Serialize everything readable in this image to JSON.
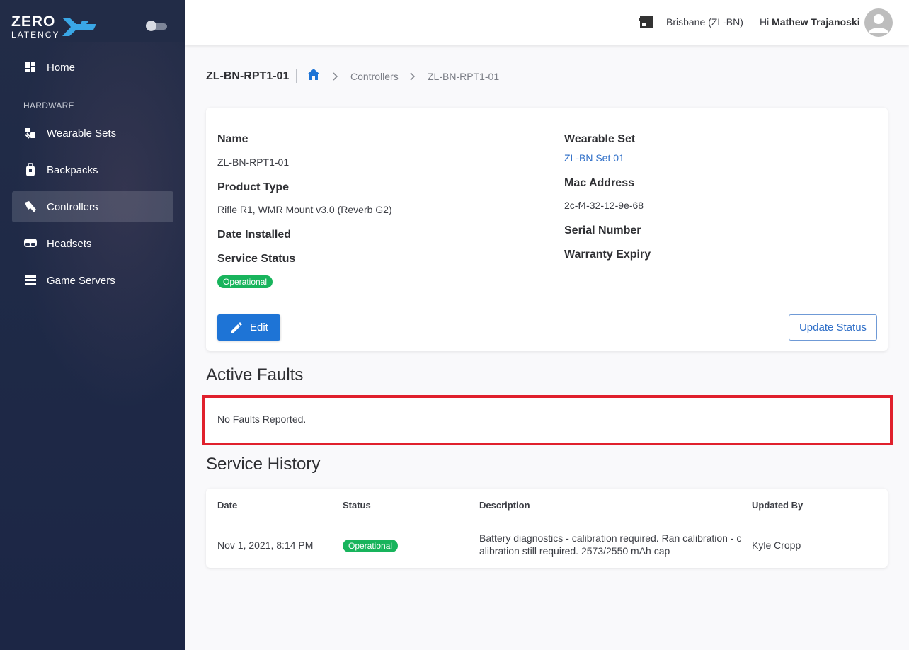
{
  "brand": {
    "line1": "ZERO",
    "line2": "LATENCY"
  },
  "sidebar": {
    "section_hardware": "HARDWARE",
    "items": [
      {
        "label": "Home",
        "icon": "dashboard-icon"
      },
      {
        "label": "Wearable Sets",
        "icon": "wearable-set-icon"
      },
      {
        "label": "Backpacks",
        "icon": "backpack-icon"
      },
      {
        "label": "Controllers",
        "icon": "controller-icon",
        "active": true
      },
      {
        "label": "Headsets",
        "icon": "headset-icon"
      },
      {
        "label": "Game Servers",
        "icon": "server-icon"
      }
    ]
  },
  "topbar": {
    "location": "Brisbane (ZL-BN)",
    "greeting_prefix": "Hi",
    "user_name": "Mathew Trajanoski"
  },
  "breadcrumb": {
    "title": "ZL-BN-RPT1-01",
    "items": [
      "Controllers",
      "ZL-BN-RPT1-01"
    ]
  },
  "details": {
    "name_label": "Name",
    "name_value": "ZL-BN-RPT1-01",
    "product_type_label": "Product Type",
    "product_type_value": "Rifle R1, WMR Mount v3.0 (Reverb G2)",
    "date_installed_label": "Date Installed",
    "service_status_label": "Service Status",
    "service_status_value": "Operational",
    "wearable_set_label": "Wearable Set",
    "wearable_set_value": "ZL-BN Set 01",
    "mac_label": "Mac Address",
    "mac_value": "2c-f4-32-12-9e-68",
    "serial_label": "Serial Number",
    "warranty_label": "Warranty Expiry",
    "edit_button": "Edit",
    "update_status_button": "Update Status"
  },
  "faults": {
    "title": "Active Faults",
    "empty_text": "No Faults Reported."
  },
  "history": {
    "title": "Service History",
    "columns": [
      "Date",
      "Status",
      "Description",
      "Updated By"
    ],
    "rows": [
      {
        "date": "Nov 1, 2021, 8:14 PM",
        "status": "Operational",
        "description_line1": "Battery diagnostics - calibration required. Ran calibration - c",
        "description_line2": "alibration still required. 2573/2550 mAh cap",
        "updated_by": "Kyle Cropp"
      }
    ]
  },
  "colors": {
    "sidebar_bg": "#1f2a47",
    "accent_blue": "#1e74d6",
    "status_green": "#18b45c",
    "highlight_red": "#e0202c"
  }
}
